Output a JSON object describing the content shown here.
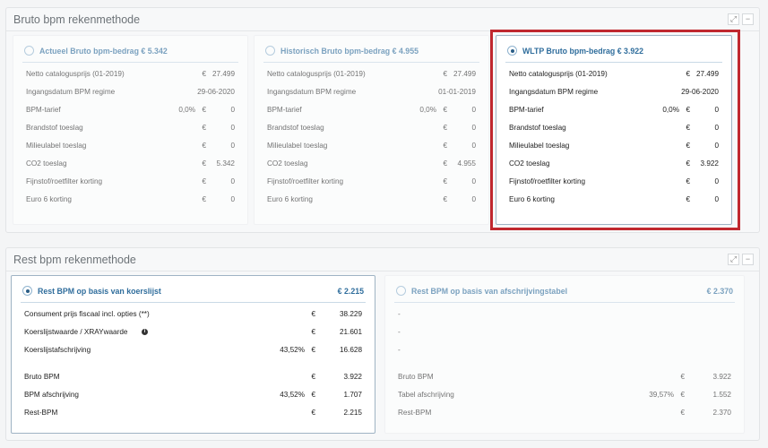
{
  "bruto": {
    "title": "Bruto bpm rekenmethode",
    "expand_icon": "expand-icon",
    "collapse_icon": "minus-icon",
    "cards": [
      {
        "title": "Actueel Bruto bpm-bedrag € 5.342",
        "selected": false,
        "rows": [
          {
            "label": "Netto catalogusprijs (01-2019)",
            "pct": "",
            "eur": "€",
            "value": "27.499"
          },
          {
            "label": "Ingangsdatum BPM regime",
            "pct": "",
            "eur": "",
            "value": "29-06-2020"
          },
          {
            "label": "BPM-tarief",
            "pct": "0,0%",
            "eur": "€",
            "value": "0"
          },
          {
            "label": "Brandstof toeslag",
            "pct": "",
            "eur": "€",
            "value": "0"
          },
          {
            "label": "Milieulabel toeslag",
            "pct": "",
            "eur": "€",
            "value": "0"
          },
          {
            "label": "CO2 toeslag",
            "pct": "",
            "eur": "€",
            "value": "5.342"
          },
          {
            "label": "Fijnstof/roetfilter korting",
            "pct": "",
            "eur": "€",
            "value": "0"
          },
          {
            "label": "Euro 6 korting",
            "pct": "",
            "eur": "€",
            "value": "0"
          }
        ]
      },
      {
        "title": "Historisch Bruto bpm-bedrag € 4.955",
        "selected": false,
        "rows": [
          {
            "label": "Netto catalogusprijs (01-2019)",
            "pct": "",
            "eur": "€",
            "value": "27.499"
          },
          {
            "label": "Ingangsdatum BPM regime",
            "pct": "",
            "eur": "",
            "value": "01-01-2019"
          },
          {
            "label": "BPM-tarief",
            "pct": "0,0%",
            "eur": "€",
            "value": "0"
          },
          {
            "label": "Brandstof toeslag",
            "pct": "",
            "eur": "€",
            "value": "0"
          },
          {
            "label": "Milieulabel toeslag",
            "pct": "",
            "eur": "€",
            "value": "0"
          },
          {
            "label": "CO2 toeslag",
            "pct": "",
            "eur": "€",
            "value": "4.955"
          },
          {
            "label": "Fijnstof/roetfilter korting",
            "pct": "",
            "eur": "€",
            "value": "0"
          },
          {
            "label": "Euro 6 korting",
            "pct": "",
            "eur": "€",
            "value": "0"
          }
        ]
      },
      {
        "title": "WLTP Bruto bpm-bedrag € 3.922",
        "selected": true,
        "rows": [
          {
            "label": "Netto catalogusprijs (01-2019)",
            "pct": "",
            "eur": "€",
            "value": "27.499"
          },
          {
            "label": "Ingangsdatum BPM regime",
            "pct": "",
            "eur": "",
            "value": "29-06-2020"
          },
          {
            "label": "BPM-tarief",
            "pct": "0,0%",
            "eur": "€",
            "value": "0"
          },
          {
            "label": "Brandstof toeslag",
            "pct": "",
            "eur": "€",
            "value": "0"
          },
          {
            "label": "Milieulabel toeslag",
            "pct": "",
            "eur": "€",
            "value": "0"
          },
          {
            "label": "CO2 toeslag",
            "pct": "",
            "eur": "€",
            "value": "3.922"
          },
          {
            "label": "Fijnstof/roetfilter korting",
            "pct": "",
            "eur": "€",
            "value": "0"
          },
          {
            "label": "Euro 6 korting",
            "pct": "",
            "eur": "€",
            "value": "0"
          }
        ]
      }
    ]
  },
  "rest": {
    "title": "Rest bpm rekenmethode",
    "cards": [
      {
        "title": "Rest BPM op basis van koerslijst",
        "amount": "€ 2.215",
        "selected": true,
        "rows": [
          {
            "label": "Consument prijs fiscaal incl. opties (**)",
            "pct": "",
            "eur": "€",
            "value": "38.229"
          },
          {
            "label": "Koerslijstwaarde / XRAYwaarde",
            "info": "i",
            "pct": "",
            "eur": "€",
            "value": "21.601"
          },
          {
            "label": "Koerslijstafschrijving",
            "pct": "43,52%",
            "eur": "€",
            "value": "16.628"
          },
          {
            "label": "Bruto BPM",
            "pct": "",
            "eur": "€",
            "value": "3.922"
          },
          {
            "label": "BPM afschrijving",
            "pct": "43,52%",
            "eur": "€",
            "value": "1.707"
          },
          {
            "label": "Rest-BPM",
            "pct": "",
            "eur": "€",
            "value": "2.215"
          }
        ]
      },
      {
        "title": "Rest BPM op basis van afschrijvingstabel",
        "amount": "€ 2.370",
        "selected": false,
        "rows": [
          {
            "label": "-",
            "pct": "",
            "eur": "",
            "value": ""
          },
          {
            "label": "-",
            "pct": "",
            "eur": "",
            "value": ""
          },
          {
            "label": "-",
            "pct": "",
            "eur": "",
            "value": ""
          },
          {
            "label": "Bruto BPM",
            "pct": "",
            "eur": "€",
            "value": "3.922"
          },
          {
            "label": "Tabel afschrijving",
            "pct": "39,57%",
            "eur": "€",
            "value": "1.552"
          },
          {
            "label": "Rest-BPM",
            "pct": "",
            "eur": "€",
            "value": "2.370"
          }
        ]
      }
    ]
  },
  "colors": {
    "accent": "#2f6d9c",
    "highlight": "#c0282f"
  }
}
